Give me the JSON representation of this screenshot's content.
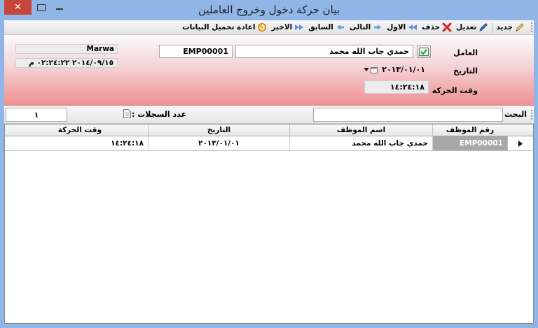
{
  "window": {
    "title": "بيان حركة دخول وخروج العاملين",
    "close_glyph": "✕"
  },
  "toolbar": {
    "items": [
      {
        "label": "جديد",
        "icon": "pencil-icon"
      },
      {
        "label": "تعديل",
        "icon": "edit-pen-icon"
      },
      {
        "label": "حذف",
        "icon": "delete-x-icon"
      },
      {
        "label": "الاول",
        "icon": "first-arrow-icon"
      },
      {
        "label": "التالى",
        "icon": "next-arrow-icon"
      },
      {
        "label": "السابق",
        "icon": "previous-arrow-icon"
      },
      {
        "label": "الاخير",
        "icon": "last-arrow-icon"
      },
      {
        "label": "اعادة تحميل البيانات",
        "icon": "reload-icon"
      }
    ]
  },
  "header": {
    "employee_label": "العامل",
    "employee_name": "حمدي جاب الله محمد",
    "employee_code": "EMP00001",
    "date_label": "التاريخ",
    "date_value": "٢٠١٣/٠١/٠١",
    "time_label": "وقت الحركة",
    "time_value": "١٤:٢٤:١٨",
    "user_name": "Marwa",
    "timestamp": "٢٠١٤/٠٩/١٥ ٠٢:٢٤:٢٢ م"
  },
  "search": {
    "label": "البحث",
    "value": "",
    "records_label": "عدد السجلات :",
    "records_count": "١"
  },
  "grid": {
    "columns": [
      "رقم الموظف",
      "اسم الموظف",
      "التاريخ",
      "وقت الحركة"
    ],
    "rows": [
      {
        "code": "EMP00001",
        "name": "حمدي جاب الله محمد",
        "date": "٢٠١٣/٠١/٠١",
        "time": "١٤:٢٤:١٨"
      }
    ]
  },
  "colors": {
    "title_bar": "#8fb6e6",
    "close_button": "#c7463a",
    "header_gradient_bottom": "#ef8f90",
    "selected_cell": "#a8a8a8"
  }
}
